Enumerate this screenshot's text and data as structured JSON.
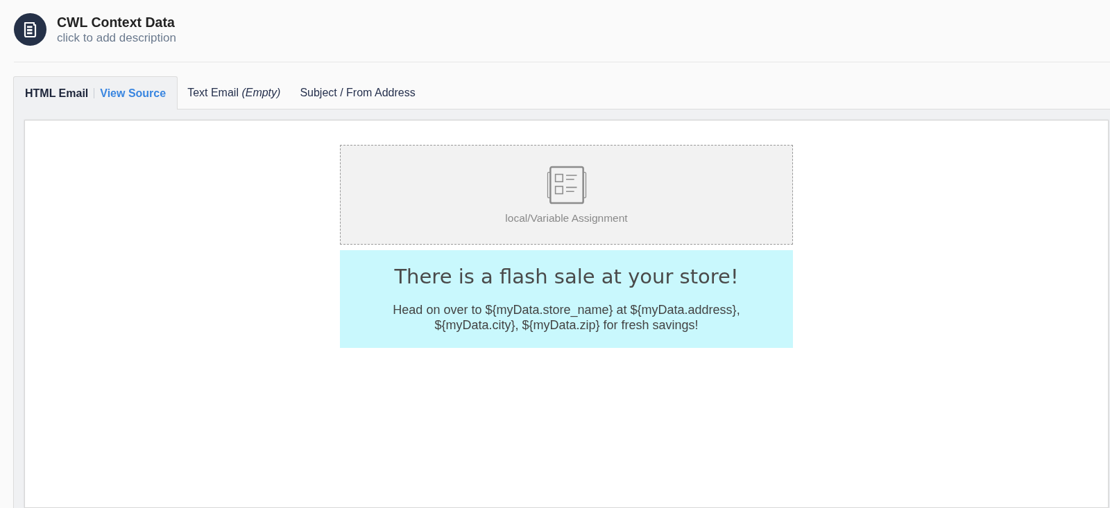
{
  "header": {
    "title": "CWL Context Data",
    "description": "click to add description"
  },
  "tabs": [
    {
      "label": "HTML Email",
      "link": "View Source",
      "selected": true
    },
    {
      "label": "Text Email *(Empty)*",
      "selected": false
    },
    {
      "label": "Subject / From Address",
      "selected": false
    }
  ],
  "canvas": {
    "blocks": [
      {
        "kind": "placeholder",
        "label": "local/Variable Assignment"
      },
      {
        "kind": "text",
        "heading": "There is a flash sale at your store!",
        "body": "Head on over to ${myData.store_name} at ${myData.address}, ${myData.city}, ${myData.zip} for fresh savings!"
      }
    ]
  }
}
